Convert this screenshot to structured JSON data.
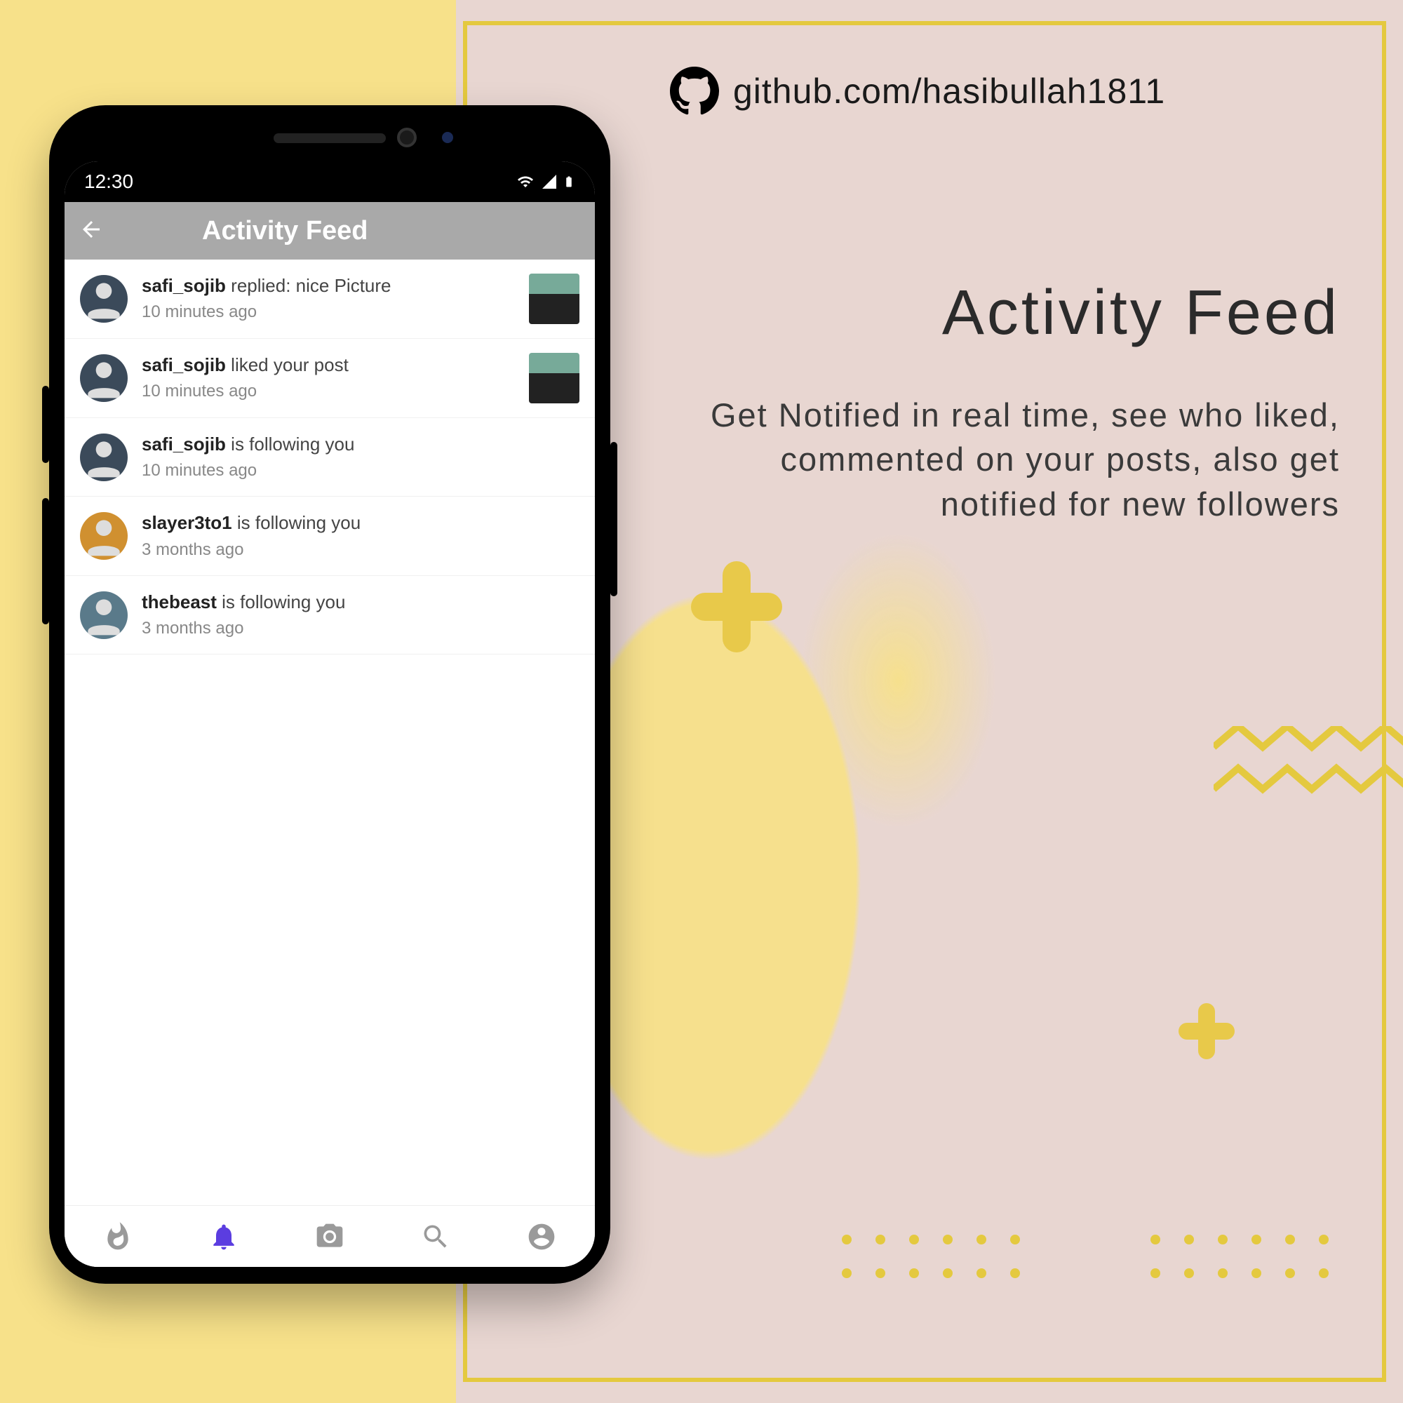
{
  "github": {
    "url_text": "github.com/hasibullah1811"
  },
  "headline": "Activity Feed",
  "subtext": "Get Notified in real time, see who liked, commented on your posts, also get notified for new followers",
  "phone": {
    "status_time": "12:30",
    "app_title": "Activity Feed",
    "feed": [
      {
        "user": "safi_sojib",
        "action": " replied: nice Picture",
        "time": "10 minutes ago",
        "avatar_color": "#3b4a5a",
        "has_thumb": true
      },
      {
        "user": "safi_sojib",
        "action": " liked your post",
        "time": "10 minutes ago",
        "avatar_color": "#3b4a5a",
        "has_thumb": true
      },
      {
        "user": "safi_sojib",
        "action": " is following you",
        "time": "10 minutes ago",
        "avatar_color": "#3b4a5a",
        "has_thumb": false
      },
      {
        "user": "slayer3to1",
        "action": " is following you",
        "time": "3 months ago",
        "avatar_color": "#d09030",
        "has_thumb": false
      },
      {
        "user": "thebeast",
        "action": " is following you",
        "time": "3 months ago",
        "avatar_color": "#5a7a8a",
        "has_thumb": false
      }
    ],
    "nav": {
      "items": [
        "fire-icon",
        "bell-icon",
        "camera-icon",
        "search-icon",
        "profile-icon"
      ],
      "active_index": 1
    }
  },
  "colors": {
    "accent_yellow": "#e4c93f",
    "bg_pink": "#e8d6d1",
    "bg_yellow": "#f7e18a"
  }
}
